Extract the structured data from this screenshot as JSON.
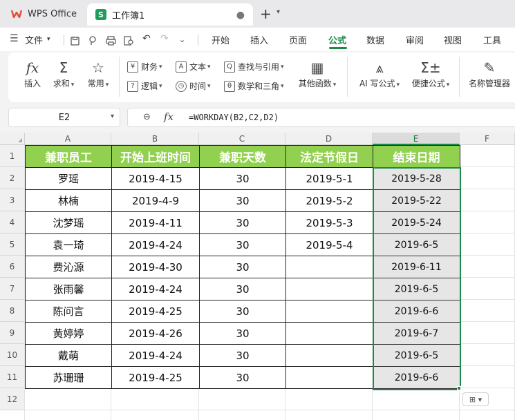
{
  "app": {
    "name": "WPS Office",
    "brand_color": "#e34b3a"
  },
  "document_tab": {
    "title": "工作簿1",
    "icon_letter": "S"
  },
  "menu": {
    "file": "文件",
    "tabs": [
      "开始",
      "插入",
      "页面",
      "公式",
      "数据",
      "审阅",
      "视图",
      "工具"
    ],
    "active_tab": "公式",
    "accent_color": "#1a8a4a"
  },
  "ribbon": {
    "insert_function": "插入",
    "autosum": "求和",
    "common": "常用",
    "finance": "财务",
    "logic": "逻辑",
    "text": "文本",
    "time": "时间",
    "lookup": "查找与引用",
    "math": "数学和三角",
    "other_functions": "其他函数",
    "ai_formula": "AI 写公式",
    "quick_formula": "便捷公式",
    "name_manager": "名称管理器"
  },
  "formula_bar": {
    "cell_ref": "E2",
    "formula": "=WORKDAY(B2,C2,D2)"
  },
  "sheet": {
    "columns": [
      "A",
      "B",
      "C",
      "D",
      "E",
      "F"
    ],
    "selected_column": "E",
    "rows": [
      "1",
      "2",
      "3",
      "4",
      "5",
      "6",
      "7",
      "8",
      "9",
      "10",
      "11",
      "12"
    ],
    "header_fill": "#92d050",
    "headers": [
      "兼职员工",
      "开始上班时间",
      "兼职天数",
      "法定节假日",
      "结束日期"
    ],
    "data": [
      [
        "罗瑶",
        "2019-4-15",
        "30",
        "2019-5-1",
        "2019-5-28"
      ],
      [
        "林楠",
        "2019-4-9",
        "30",
        "2019-5-2",
        "2019-5-22"
      ],
      [
        "沈梦瑶",
        "2019-4-11",
        "30",
        "2019-5-3",
        "2019-5-24"
      ],
      [
        "袁一琦",
        "2019-4-24",
        "30",
        "2019-5-4",
        "2019-6-5"
      ],
      [
        "费沁源",
        "2019-4-30",
        "30",
        "",
        "2019-6-11"
      ],
      [
        "张雨馨",
        "2019-4-24",
        "30",
        "",
        "2019-6-5"
      ],
      [
        "陈问言",
        "2019-4-25",
        "30",
        "",
        "2019-6-6"
      ],
      [
        "黄婷婷",
        "2019-4-26",
        "30",
        "",
        "2019-6-7"
      ],
      [
        "戴萌",
        "2019-4-24",
        "30",
        "",
        "2019-6-5"
      ],
      [
        "苏珊珊",
        "2019-4-25",
        "30",
        "",
        "2019-6-6"
      ]
    ]
  }
}
